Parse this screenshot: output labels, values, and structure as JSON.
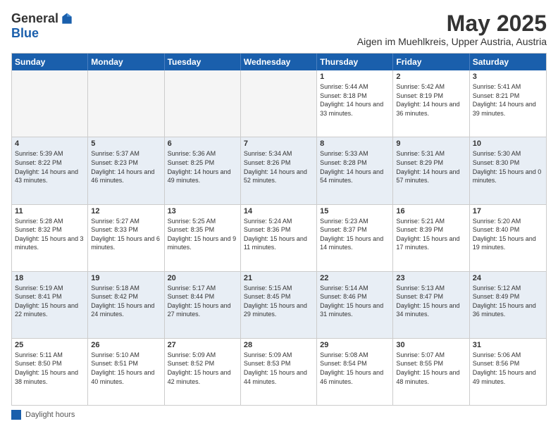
{
  "logo": {
    "general": "General",
    "blue": "Blue"
  },
  "header": {
    "month": "May 2025",
    "location": "Aigen im Muehlkreis, Upper Austria, Austria"
  },
  "weekdays": [
    "Sunday",
    "Monday",
    "Tuesday",
    "Wednesday",
    "Thursday",
    "Friday",
    "Saturday"
  ],
  "footer": {
    "label": "Daylight hours"
  },
  "rows": [
    {
      "cells": [
        {
          "empty": true
        },
        {
          "empty": true
        },
        {
          "empty": true
        },
        {
          "empty": true
        },
        {
          "day": 1,
          "sunrise": "5:44 AM",
          "sunset": "8:18 PM",
          "daylight": "14 hours and 33 minutes."
        },
        {
          "day": 2,
          "sunrise": "5:42 AM",
          "sunset": "8:19 PM",
          "daylight": "14 hours and 36 minutes."
        },
        {
          "day": 3,
          "sunrise": "5:41 AM",
          "sunset": "8:21 PM",
          "daylight": "14 hours and 39 minutes."
        }
      ]
    },
    {
      "cells": [
        {
          "day": 4,
          "sunrise": "5:39 AM",
          "sunset": "8:22 PM",
          "daylight": "14 hours and 43 minutes."
        },
        {
          "day": 5,
          "sunrise": "5:37 AM",
          "sunset": "8:23 PM",
          "daylight": "14 hours and 46 minutes."
        },
        {
          "day": 6,
          "sunrise": "5:36 AM",
          "sunset": "8:25 PM",
          "daylight": "14 hours and 49 minutes."
        },
        {
          "day": 7,
          "sunrise": "5:34 AM",
          "sunset": "8:26 PM",
          "daylight": "14 hours and 52 minutes."
        },
        {
          "day": 8,
          "sunrise": "5:33 AM",
          "sunset": "8:28 PM",
          "daylight": "14 hours and 54 minutes."
        },
        {
          "day": 9,
          "sunrise": "5:31 AM",
          "sunset": "8:29 PM",
          "daylight": "14 hours and 57 minutes."
        },
        {
          "day": 10,
          "sunrise": "5:30 AM",
          "sunset": "8:30 PM",
          "daylight": "15 hours and 0 minutes."
        }
      ]
    },
    {
      "cells": [
        {
          "day": 11,
          "sunrise": "5:28 AM",
          "sunset": "8:32 PM",
          "daylight": "15 hours and 3 minutes."
        },
        {
          "day": 12,
          "sunrise": "5:27 AM",
          "sunset": "8:33 PM",
          "daylight": "15 hours and 6 minutes."
        },
        {
          "day": 13,
          "sunrise": "5:25 AM",
          "sunset": "8:35 PM",
          "daylight": "15 hours and 9 minutes."
        },
        {
          "day": 14,
          "sunrise": "5:24 AM",
          "sunset": "8:36 PM",
          "daylight": "15 hours and 11 minutes."
        },
        {
          "day": 15,
          "sunrise": "5:23 AM",
          "sunset": "8:37 PM",
          "daylight": "15 hours and 14 minutes."
        },
        {
          "day": 16,
          "sunrise": "5:21 AM",
          "sunset": "8:39 PM",
          "daylight": "15 hours and 17 minutes."
        },
        {
          "day": 17,
          "sunrise": "5:20 AM",
          "sunset": "8:40 PM",
          "daylight": "15 hours and 19 minutes."
        }
      ]
    },
    {
      "cells": [
        {
          "day": 18,
          "sunrise": "5:19 AM",
          "sunset": "8:41 PM",
          "daylight": "15 hours and 22 minutes."
        },
        {
          "day": 19,
          "sunrise": "5:18 AM",
          "sunset": "8:42 PM",
          "daylight": "15 hours and 24 minutes."
        },
        {
          "day": 20,
          "sunrise": "5:17 AM",
          "sunset": "8:44 PM",
          "daylight": "15 hours and 27 minutes."
        },
        {
          "day": 21,
          "sunrise": "5:15 AM",
          "sunset": "8:45 PM",
          "daylight": "15 hours and 29 minutes."
        },
        {
          "day": 22,
          "sunrise": "5:14 AM",
          "sunset": "8:46 PM",
          "daylight": "15 hours and 31 minutes."
        },
        {
          "day": 23,
          "sunrise": "5:13 AM",
          "sunset": "8:47 PM",
          "daylight": "15 hours and 34 minutes."
        },
        {
          "day": 24,
          "sunrise": "5:12 AM",
          "sunset": "8:49 PM",
          "daylight": "15 hours and 36 minutes."
        }
      ]
    },
    {
      "cells": [
        {
          "day": 25,
          "sunrise": "5:11 AM",
          "sunset": "8:50 PM",
          "daylight": "15 hours and 38 minutes."
        },
        {
          "day": 26,
          "sunrise": "5:10 AM",
          "sunset": "8:51 PM",
          "daylight": "15 hours and 40 minutes."
        },
        {
          "day": 27,
          "sunrise": "5:09 AM",
          "sunset": "8:52 PM",
          "daylight": "15 hours and 42 minutes."
        },
        {
          "day": 28,
          "sunrise": "5:09 AM",
          "sunset": "8:53 PM",
          "daylight": "15 hours and 44 minutes."
        },
        {
          "day": 29,
          "sunrise": "5:08 AM",
          "sunset": "8:54 PM",
          "daylight": "15 hours and 46 minutes."
        },
        {
          "day": 30,
          "sunrise": "5:07 AM",
          "sunset": "8:55 PM",
          "daylight": "15 hours and 48 minutes."
        },
        {
          "day": 31,
          "sunrise": "5:06 AM",
          "sunset": "8:56 PM",
          "daylight": "15 hours and 49 minutes."
        }
      ]
    }
  ]
}
